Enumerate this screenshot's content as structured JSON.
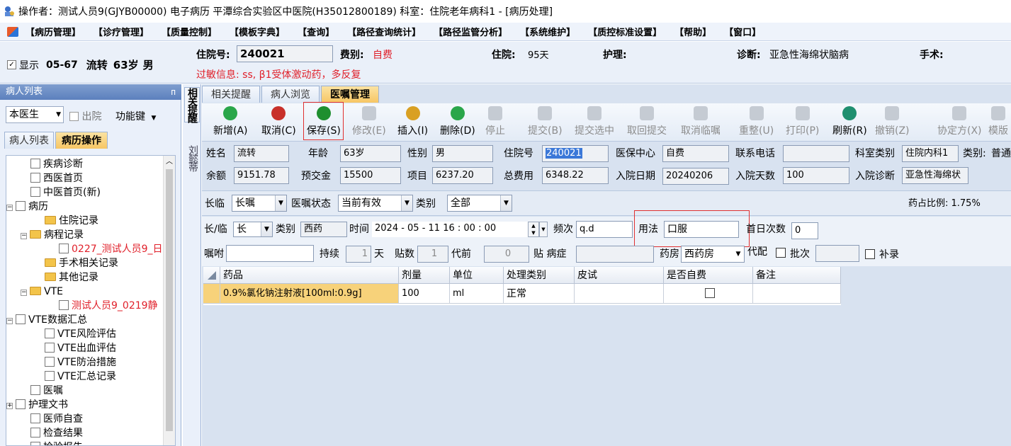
{
  "window": {
    "title": "操作者：测试人员9(GJYB00000) 电子病历  平潭综合实验区中医院(H35012800189)  科室：住院老年病科1 - [病历处理]"
  },
  "menu": [
    "【病历管理】",
    "【诊疗管理】",
    "【质量控制】",
    "【模板字典】",
    "【查询】",
    "【路径查询统计】",
    "【路径监管分析】",
    "【系统维护】",
    "【质控标准设置】",
    "【帮助】",
    "【窗口】"
  ],
  "info": {
    "show_label": "显示",
    "bed": "05-67",
    "patient": "流转",
    "age": "63岁",
    "sex": "男",
    "inpatient_no_label": "住院号:",
    "inpatient_no": "240021",
    "fee_type_label": "费别:",
    "fee_type": "自费",
    "stay_label": "住院:",
    "stay": "95天",
    "nursing_label": "护理:",
    "diagnosis_label": "诊断:",
    "diagnosis": "亚急性海绵状脑病",
    "surgery_label": "手术:",
    "allergy": "过敏信息: ss, β1受体激动药，多反复"
  },
  "left": {
    "header": "病人列表",
    "pin": "ᴨ",
    "doctor": "本医生",
    "discharged": "出院",
    "function_key": "功能键",
    "tab_list": "病人列表",
    "tab_ops": "病历操作",
    "tree": [
      {
        "label": "疾病诊断",
        "depth": 1,
        "kind": "doc"
      },
      {
        "label": "西医首页",
        "depth": 1,
        "kind": "doc"
      },
      {
        "label": "中医首页(新)",
        "depth": 1,
        "kind": "doc"
      },
      {
        "label": "病历",
        "depth": 0,
        "kind": "doc",
        "exp": "−"
      },
      {
        "label": "住院记录",
        "depth": 2,
        "kind": "folder"
      },
      {
        "label": "病程记录",
        "depth": 1,
        "kind": "folder",
        "exp": "−"
      },
      {
        "label": "0227_测试人员9_日",
        "depth": 3,
        "kind": "doc",
        "red": true
      },
      {
        "label": "手术相关记录",
        "depth": 2,
        "kind": "folder"
      },
      {
        "label": "其他记录",
        "depth": 2,
        "kind": "folder"
      },
      {
        "label": "VTE",
        "depth": 1,
        "kind": "folder",
        "exp": "−"
      },
      {
        "label": "测试人员9_0219静",
        "depth": 3,
        "kind": "doc",
        "red": true
      },
      {
        "label": "VTE数据汇总",
        "depth": 0,
        "kind": "doc",
        "exp": "−"
      },
      {
        "label": "VTE风险评估",
        "depth": 2,
        "kind": "doc"
      },
      {
        "label": "VTE出血评估",
        "depth": 2,
        "kind": "doc"
      },
      {
        "label": "VTE防治措施",
        "depth": 2,
        "kind": "doc"
      },
      {
        "label": "VTE汇总记录",
        "depth": 2,
        "kind": "doc"
      },
      {
        "label": "医嘱",
        "depth": 1,
        "kind": "doc"
      },
      {
        "label": "护理文书",
        "depth": 0,
        "kind": "doc",
        "exp": "+"
      },
      {
        "label": "医师自查",
        "depth": 1,
        "kind": "doc"
      },
      {
        "label": "检查结果",
        "depth": 1,
        "kind": "doc"
      },
      {
        "label": "检验报告",
        "depth": 1,
        "kind": "doc"
      }
    ]
  },
  "vtabs": [
    "相关提醒",
    "刘懿蒂"
  ],
  "tabs": [
    "相关提醒",
    "病人浏览",
    "医嘱管理"
  ],
  "toolbar": [
    {
      "label": "新增(A)",
      "color": "#2aa64a",
      "enabled": true
    },
    {
      "label": "取消(C)",
      "color": "#c8302a",
      "enabled": true
    },
    {
      "label": "保存(S)",
      "color": "#1f8f2f",
      "enabled": true
    },
    {
      "label": "修改(E)",
      "enabled": false
    },
    {
      "label": "插入(I)",
      "color": "#d9a023",
      "enabled": true
    },
    {
      "label": "删除(D)",
      "color": "#2aa64a",
      "enabled": true
    },
    {
      "label": "停止",
      "enabled": false
    },
    {
      "label": "提交(B)",
      "enabled": false
    },
    {
      "label": "提交选中",
      "enabled": false
    },
    {
      "label": "取回提交",
      "enabled": false
    },
    {
      "label": "取消临嘱",
      "enabled": false
    },
    {
      "label": "重整(U)",
      "enabled": false
    },
    {
      "label": "打印(P)",
      "enabled": false
    },
    {
      "label": "刷新(R)",
      "color": "#1f8f6f",
      "enabled": true
    },
    {
      "label": "撤销(Z)",
      "enabled": false
    },
    {
      "label": "协定方(X)",
      "enabled": false
    },
    {
      "label": "模版",
      "enabled": false
    }
  ],
  "patient": {
    "name_label": "姓名",
    "name": "流转",
    "age_label": "年龄",
    "age": "63岁",
    "sex_label": "性别",
    "sex": "男",
    "no_label": "住院号",
    "no": "240021",
    "insurance_label": "医保中心",
    "insurance": "自费",
    "phone_label": "联系电话",
    "phone": "",
    "dept_label": "科室类别",
    "dept": "住院内科1",
    "class_label": "类别:",
    "class_value": "普通",
    "balance_label": "余额",
    "balance": "9151.78",
    "deposit_label": "预交金",
    "deposit": "15500",
    "item_label": "项目",
    "item": "6237.20",
    "total_label": "总费用",
    "total": "6348.22",
    "admit_date_label": "入院日期",
    "admit_date": "20240206",
    "admit_days_label": "入院天数",
    "admit_days": "100",
    "admit_diag_label": "入院诊断",
    "admit_diag": "亚急性海绵状"
  },
  "filter": {
    "long_label": "长临",
    "long_value": "长嘱",
    "status_label": "医嘱状态",
    "status_value": "当前有效",
    "type_label": "类别",
    "type_value": "全部",
    "ratio": "药占比例: 1.75%"
  },
  "order": {
    "lt_label": "长/临",
    "lt_value": "长",
    "cat_label": "类别",
    "cat_value": "西药",
    "time_label": "时间",
    "time_value": "2024 - 05 - 11   16 : 00 : 00",
    "freq_label": "频次",
    "freq_value": "q.d",
    "usage_label": "用法",
    "usage_value": "口服",
    "first_label": "首日次数",
    "first_value": "0",
    "note_label": "嘱咐",
    "note_value": "",
    "duration_label": "持续",
    "duration_value": "1",
    "day_unit": "天",
    "paste_label": "贴数",
    "paste_value": "1",
    "decoct_label": "代前",
    "decoct_value": "0",
    "disease_label": "贴 病症",
    "disease_value": "",
    "pharmacy_label": "药房",
    "pharmacy_value": "西药房",
    "proxy_label": "代配",
    "batch_label": "批次",
    "batch_value": "",
    "supp_label": "补录"
  },
  "grid": {
    "headers": [
      "药品",
      "剂量",
      "单位",
      "处理类别",
      "皮试",
      "是否自费",
      "备注"
    ],
    "rows": [
      {
        "drug": "0.9%氯化钠注射液[100ml:0.9g]",
        "dose": "100",
        "unit": "ml",
        "proc": "正常",
        "skin": "",
        "self": "",
        "note": ""
      }
    ]
  }
}
